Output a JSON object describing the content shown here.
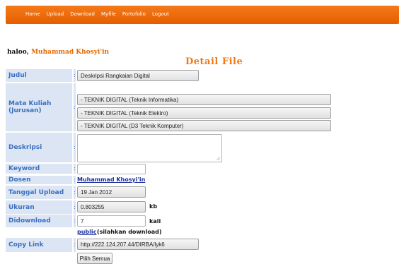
{
  "nav": [
    "Home",
    "Upload",
    "Download",
    "Myfile",
    "Portofolio",
    "Logout"
  ],
  "greeting": {
    "prefix": "haloo, ",
    "name": "Muhammad Khosyi'in"
  },
  "page_title": "Detail File",
  "fields": {
    "judul": {
      "label": "Judul",
      "value": "Deskripsi Rangkaian Digital"
    },
    "mata_kuliah": {
      "label_line1": "Mata Kuliah",
      "label_line2": "(Jurusan)",
      "values": [
        "- TEKNIK DIGITAL (Teknik Informatika)",
        "- TEKNIK DIGITAL (Teknik Elektro)",
        "- TEKNIK DIGITAL (D3 Teknik Komputer)"
      ]
    },
    "deskripsi": {
      "label": "Deskripsi",
      "value": ""
    },
    "keyword": {
      "label": "Keyword",
      "value": ""
    },
    "dosen": {
      "label": "Dosen",
      "value": "Muhammad Khosyi'in"
    },
    "tanggal": {
      "label": "Tanggal Upload",
      "value": "19 Jan 2012"
    },
    "ukuran": {
      "label": "Ukuran",
      "value": "0.803255",
      "unit": "kb"
    },
    "didownload": {
      "label": "Didownload",
      "value": "7",
      "unit": "kali"
    },
    "status": {
      "link": "public",
      "note": " (silahkan download)"
    },
    "copy_link": {
      "label": "Copy Link",
      "value": "http://222.124.207.44/DIRBA/lyk6"
    }
  },
  "select_all_button": "Pilih Semua",
  "colon": ":"
}
